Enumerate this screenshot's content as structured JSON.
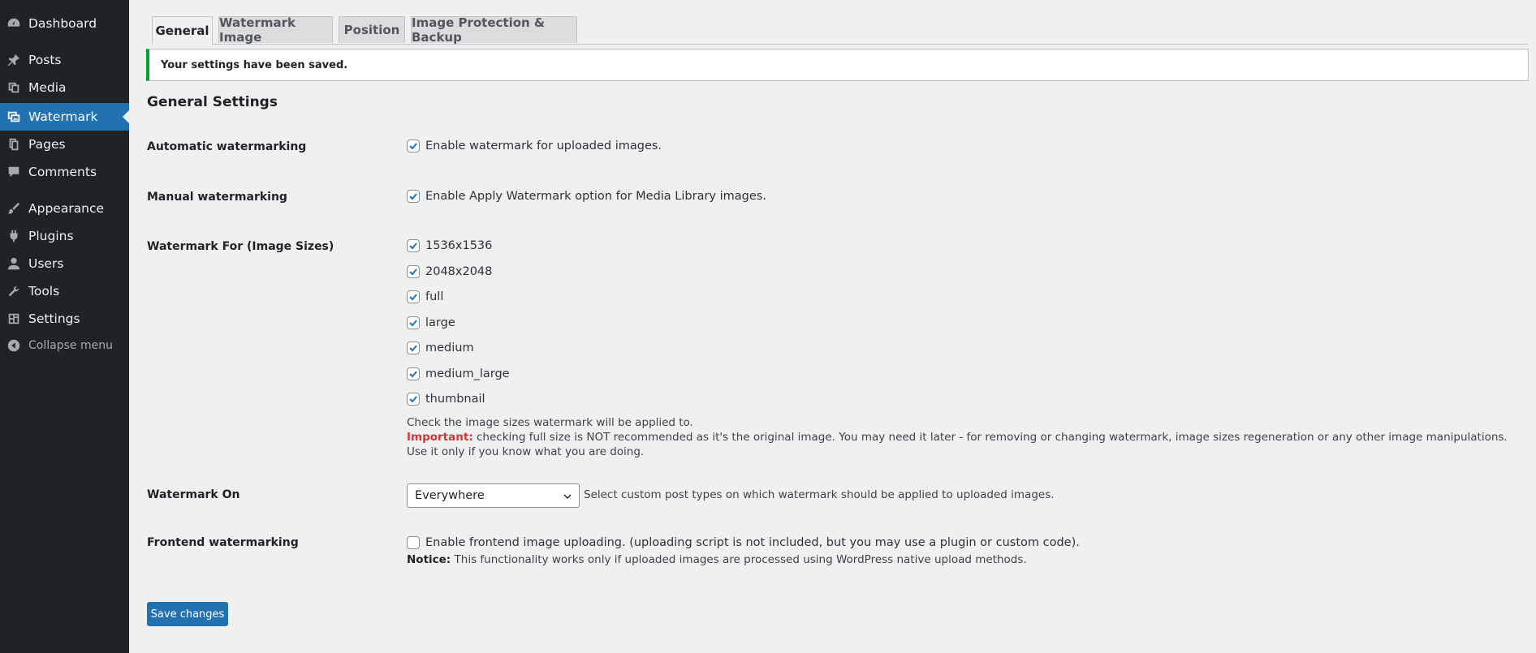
{
  "sidebar": {
    "items": [
      {
        "label": "Dashboard",
        "icon": "dashboard-icon"
      },
      {
        "label": "Posts",
        "icon": "pushpin-icon"
      },
      {
        "label": "Media",
        "icon": "media-icon"
      },
      {
        "label": "Watermark",
        "icon": "watermark-icon",
        "active": true
      },
      {
        "label": "Pages",
        "icon": "pages-icon"
      },
      {
        "label": "Comments",
        "icon": "comment-icon"
      },
      {
        "label": "Appearance",
        "icon": "brush-icon"
      },
      {
        "label": "Plugins",
        "icon": "plug-icon"
      },
      {
        "label": "Users",
        "icon": "user-icon"
      },
      {
        "label": "Tools",
        "icon": "wrench-icon"
      },
      {
        "label": "Settings",
        "icon": "settings-icon"
      }
    ],
    "collapse_label": "Collapse menu"
  },
  "tabs": [
    "General",
    "Watermark Image",
    "Position",
    "Image Protection & Backup"
  ],
  "notice": "Your settings have been saved.",
  "page_title": "General Settings",
  "automatic": {
    "label": "Automatic watermarking",
    "option": "Enable watermark for uploaded images.",
    "checked": true
  },
  "manual": {
    "label": "Manual watermarking",
    "option": "Enable Apply Watermark option for Media Library images.",
    "checked": true
  },
  "sizes": {
    "label": "Watermark For (Image Sizes)",
    "options": [
      "1536x1536",
      "2048x2048",
      "full",
      "large",
      "medium",
      "medium_large",
      "thumbnail"
    ],
    "description": "Check the image sizes watermark will be applied to.",
    "important_label": "Important:",
    "important_text": " checking full size is NOT recommended as it's the original image. You may need it later - for removing or changing watermark, image sizes regeneration or any other image manipulations. Use it only if you know what you are doing."
  },
  "watermark_on": {
    "label": "Watermark On",
    "selected": "Everywhere",
    "description": "Select custom post types on which watermark should be applied to uploaded images."
  },
  "frontend": {
    "label": "Frontend watermarking",
    "option": "Enable frontend image uploading. (uploading script is not included, but you may use a plugin or custom code).",
    "checked": false,
    "notice_label": "Notice:",
    "notice_text": " This functionality works only if uploaded images are processed using WordPress native upload methods."
  },
  "save_label": "Save changes",
  "colors": {
    "accent": "#2271b1",
    "sidebar": "#1d2327",
    "success": "#00a32a",
    "important": "#d63638"
  }
}
